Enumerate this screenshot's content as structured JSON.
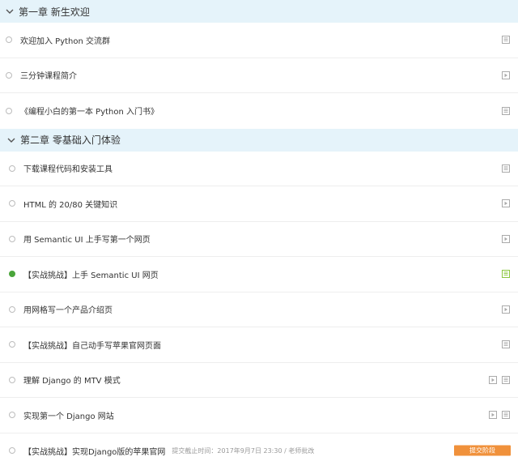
{
  "chapters": [
    {
      "title": "第一章 新生欢迎",
      "lessons": [
        {
          "title": "欢迎加入 Python 交流群",
          "icons": [
            "document-icon"
          ]
        },
        {
          "title": "三分钟课程简介",
          "icons": [
            "video-icon"
          ]
        },
        {
          "title": "《编程小白的第一本 Python 入门书》",
          "icons": [
            "document-icon"
          ]
        }
      ]
    },
    {
      "title": "第二章 零基础入门体验",
      "lessons": [
        {
          "title": "下载课程代码和安装工具",
          "icons": [
            "document-icon"
          ]
        },
        {
          "title": "HTML 的 20/80 关键知识",
          "icons": [
            "video-icon"
          ]
        },
        {
          "title": "用 Semantic UI 上手写第一个网页",
          "icons": [
            "video-icon"
          ]
        },
        {
          "title": "【实战挑战】上手 Semantic UI 网页",
          "icons": [
            "document-icon"
          ],
          "active": true
        },
        {
          "title": "用网格写一个产品介绍页",
          "icons": [
            "video-icon"
          ]
        },
        {
          "title": "【实战挑战】自己动手写苹果官网页面",
          "icons": [
            "document-icon"
          ]
        },
        {
          "title": "理解 Django 的 MTV 模式",
          "icons": [
            "video-icon",
            "document-icon"
          ]
        },
        {
          "title": "实现第一个 Django 网站",
          "icons": [
            "video-icon",
            "document-icon"
          ]
        },
        {
          "title": "【实战挑战】实现Django版的苹果官网",
          "meta": "提交截止时间：2017年9月7日 23:30 / 老师批改",
          "button": "提交阶段"
        }
      ]
    }
  ],
  "colors": {
    "chapter_bg": "#e5f3fa",
    "active_dot": "#4aa53b",
    "active_icon": "#8cc63f",
    "icon": "#aaaaaa",
    "button": "#f0913b"
  }
}
